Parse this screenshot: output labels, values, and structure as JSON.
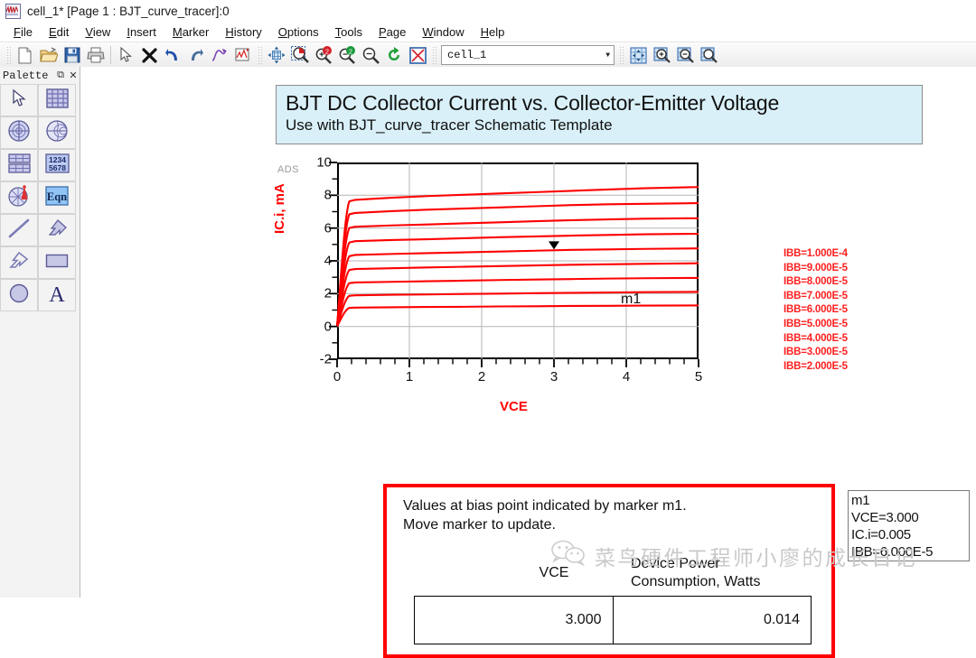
{
  "window": {
    "title": "cell_1* [Page 1 : BJT_curve_tracer]:0",
    "app_icon": "waveform-icon"
  },
  "menu": [
    {
      "label": "File",
      "mnemonic": "F"
    },
    {
      "label": "Edit",
      "mnemonic": "E"
    },
    {
      "label": "View",
      "mnemonic": "V"
    },
    {
      "label": "Insert",
      "mnemonic": "I"
    },
    {
      "label": "Marker",
      "mnemonic": "M"
    },
    {
      "label": "History",
      "mnemonic": "H"
    },
    {
      "label": "Options",
      "mnemonic": "O"
    },
    {
      "label": "Tools",
      "mnemonic": "T"
    },
    {
      "label": "Page",
      "mnemonic": "P"
    },
    {
      "label": "Window",
      "mnemonic": "W"
    },
    {
      "label": "Help",
      "mnemonic": "H"
    }
  ],
  "toolbar": {
    "group1": [
      "new-file-icon",
      "open-folder-icon",
      "save-icon",
      "print-icon"
    ],
    "group2": [
      "pointer-select-icon",
      "delete-x-icon",
      "undo-icon",
      "redo-icon",
      "trace-icon",
      "annotate-plot-icon"
    ],
    "group3": [
      "pan-icon",
      "zoom-area-icon",
      "zoom-in-2-icon",
      "zoom-out-2-icon",
      "zoom-reset-icon",
      "refresh-icon",
      "stop-icon"
    ],
    "cell_selector": {
      "value": "cell_1",
      "options": [
        "cell_1"
      ]
    },
    "group4": [
      "fit-page-icon",
      "page-zoom-in-icon",
      "page-zoom-out-icon",
      "page-zoom-area-icon"
    ]
  },
  "palette": {
    "title": "Palette",
    "float_button": "restore-icon",
    "close_button": "close-icon",
    "items": [
      {
        "name": "pointer-tool",
        "icon": "arrow-cursor-icon"
      },
      {
        "name": "rectangular-plot-tool",
        "icon": "grid-plot-icon"
      },
      {
        "name": "polar-plot-tool",
        "icon": "polar-plot-icon"
      },
      {
        "name": "smith-chart-tool",
        "icon": "smith-chart-icon"
      },
      {
        "name": "list-table-tool",
        "icon": "table-icon"
      },
      {
        "name": "numeric-display-tool",
        "icon": "digits-1234-5678-icon"
      },
      {
        "name": "antenna-plot-tool",
        "icon": "antenna-icon"
      },
      {
        "name": "equation-tool",
        "icon": "eqn-icon"
      },
      {
        "name": "line-tool",
        "icon": "diagonal-line-icon"
      },
      {
        "name": "arrow-shape-tool",
        "icon": "filled-arrow-icon"
      },
      {
        "name": "open-arrow-tool",
        "icon": "outline-arrow-icon"
      },
      {
        "name": "rectangle-tool",
        "icon": "rectangle-icon"
      },
      {
        "name": "ellipse-tool",
        "icon": "circle-icon"
      },
      {
        "name": "text-tool",
        "icon": "text-a-icon"
      }
    ]
  },
  "header_block": {
    "title": "BJT DC Collector Current vs. Collector-Emitter Voltage",
    "subtitle": "Use with BJT_curve_tracer Schematic Template",
    "background": "#d9f0f8"
  },
  "plot": {
    "watermark_label": "ADS",
    "marker_label": "m1"
  },
  "marker_box": {
    "name": "m1",
    "lines": [
      "m1",
      "VCE=3.000",
      "IC.i=0.005",
      "IBB=6.000E-5"
    ]
  },
  "results": {
    "note_line1": "Values at bias point indicated by marker m1.",
    "note_line2": "Move marker to update.",
    "col1_header": "VCE",
    "col2_header_line1": "Device Power",
    "col2_header_line2": "Consumption, Watts",
    "col1_value": "3.000",
    "col2_value": "0.014",
    "border_color": "#ff0000"
  },
  "watermark": {
    "icon": "wechat-icon",
    "text": "菜鸟硬件工程师小廖的成长日记"
  },
  "chart_data": {
    "type": "line",
    "title": "BJT DC Collector Current vs. Collector-Emitter Voltage",
    "xlabel": "VCE",
    "ylabel": "IC.i, mA",
    "xlim": [
      0,
      5
    ],
    "ylim": [
      -2,
      10
    ],
    "xticks": [
      0,
      1,
      2,
      3,
      4,
      5
    ],
    "yticks": [
      -2,
      0,
      2,
      4,
      6,
      8,
      10
    ],
    "x_minor_step": 0.2,
    "y_minor_step": 1,
    "grid": "horizontal-major",
    "legend_position": "right",
    "series_color": "#ff0000",
    "marker": {
      "label": "m1",
      "x": 3.0,
      "y": 4.75,
      "series": "IBB=6.000E-5"
    },
    "series": [
      {
        "name": "IBB=1.000E-4",
        "knee_y": 7.75,
        "values": [
          0.0,
          7.72,
          7.85,
          7.95,
          8.03,
          8.11,
          8.19,
          8.27,
          8.35,
          8.43,
          8.5
        ],
        "x": [
          0,
          0.25,
          0.75,
          1.25,
          1.75,
          2.25,
          2.75,
          3.25,
          3.75,
          4.25,
          5.0
        ]
      },
      {
        "name": "IBB=9.000E-5",
        "knee_y": 6.95,
        "values": [
          0.0,
          6.92,
          7.03,
          7.12,
          7.19,
          7.26,
          7.33,
          7.4,
          7.45,
          7.48,
          7.52
        ],
        "x": [
          0,
          0.25,
          0.75,
          1.25,
          1.75,
          2.25,
          2.75,
          3.25,
          3.75,
          4.25,
          5.0
        ]
      },
      {
        "name": "IBB=8.000E-5",
        "knee_y": 6.1,
        "values": [
          0.0,
          6.08,
          6.16,
          6.22,
          6.29,
          6.35,
          6.42,
          6.48,
          6.53,
          6.57,
          6.6
        ],
        "x": [
          0,
          0.25,
          0.75,
          1.25,
          1.75,
          2.25,
          2.75,
          3.25,
          3.75,
          4.25,
          5.0
        ]
      },
      {
        "name": "IBB=7.000E-5",
        "knee_y": 5.2,
        "values": [
          0.0,
          5.2,
          5.27,
          5.32,
          5.38,
          5.44,
          5.49,
          5.54,
          5.58,
          5.62,
          5.65
        ],
        "x": [
          0,
          0.25,
          0.75,
          1.25,
          1.75,
          2.25,
          2.75,
          3.25,
          3.75,
          4.25,
          5.0
        ]
      },
      {
        "name": "IBB=6.000E-5",
        "knee_y": 4.35,
        "values": [
          0.0,
          4.36,
          4.42,
          4.47,
          4.52,
          4.57,
          4.62,
          4.67,
          4.7,
          4.73,
          4.76
        ],
        "x": [
          0,
          0.25,
          0.75,
          1.25,
          1.75,
          2.25,
          2.75,
          3.25,
          3.75,
          4.25,
          5.0
        ]
      },
      {
        "name": "IBB=5.000E-5",
        "knee_y": 3.5,
        "values": [
          0.0,
          3.5,
          3.55,
          3.6,
          3.64,
          3.68,
          3.72,
          3.76,
          3.79,
          3.82,
          3.85
        ],
        "x": [
          0,
          0.25,
          0.75,
          1.25,
          1.75,
          2.25,
          2.75,
          3.25,
          3.75,
          4.25,
          5.0
        ]
      },
      {
        "name": "IBB=4.000E-5",
        "knee_y": 2.68,
        "values": [
          0.0,
          2.68,
          2.72,
          2.76,
          2.79,
          2.83,
          2.86,
          2.89,
          2.92,
          2.94,
          2.96
        ],
        "x": [
          0,
          0.25,
          0.75,
          1.25,
          1.75,
          2.25,
          2.75,
          3.25,
          3.75,
          4.25,
          5.0
        ]
      },
      {
        "name": "IBB=3.000E-5",
        "knee_y": 1.9,
        "values": [
          0.0,
          1.9,
          1.93,
          1.95,
          1.98,
          2.0,
          2.03,
          2.05,
          2.07,
          2.09,
          2.11
        ],
        "x": [
          0,
          0.25,
          0.75,
          1.25,
          1.75,
          2.25,
          2.75,
          3.25,
          3.75,
          4.25,
          5.0
        ]
      },
      {
        "name": "IBB=2.000E-5",
        "knee_y": 1.15,
        "values": [
          0.0,
          1.15,
          1.17,
          1.19,
          1.2,
          1.22,
          1.23,
          1.25,
          1.26,
          1.27,
          1.28
        ],
        "x": [
          0,
          0.25,
          0.75,
          1.25,
          1.75,
          2.25,
          2.75,
          3.25,
          3.75,
          4.25,
          5.0
        ]
      }
    ]
  }
}
